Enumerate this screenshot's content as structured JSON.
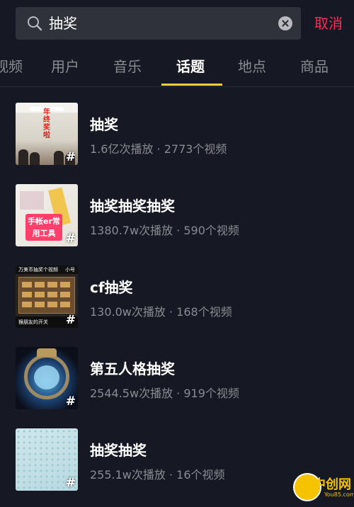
{
  "search": {
    "query": "抽奖",
    "cancel_label": "取消"
  },
  "tabs": [
    {
      "label": "视频",
      "active": false
    },
    {
      "label": "用户",
      "active": false
    },
    {
      "label": "音乐",
      "active": false
    },
    {
      "label": "话题",
      "active": true
    },
    {
      "label": "地点",
      "active": false
    },
    {
      "label": "商品",
      "active": false
    }
  ],
  "results": [
    {
      "title": "抽奖",
      "meta": "1.6亿次播放 · 2773个视频",
      "thumb_text": "年终奖啦",
      "hash": "#"
    },
    {
      "title": "抽奖抽奖抽奖",
      "meta": "1380.7w次播放 · 590个视频",
      "thumb_text": "手帐er常用工具",
      "hash": "#"
    },
    {
      "title": "cf抽奖",
      "meta": "130.0w次播放 · 168个视频",
      "thumb_text": "万美币抽奖个视频",
      "thumb_tag": "小号",
      "thumb_foot": "猴朋友的开关",
      "hash": "#"
    },
    {
      "title": "第五人格抽奖",
      "meta": "2544.5w次播放 · 919个视频",
      "hash": "#"
    },
    {
      "title": "抽奖抽奖",
      "meta": "255.1w次播放 · 16个视频",
      "hash": "#"
    }
  ],
  "watermark": {
    "brand": "中创网",
    "sub": "You85.com"
  },
  "colors": {
    "background": "#161823",
    "accent_cancel": "#fe2c55",
    "tab_underline": "#facd3c"
  }
}
